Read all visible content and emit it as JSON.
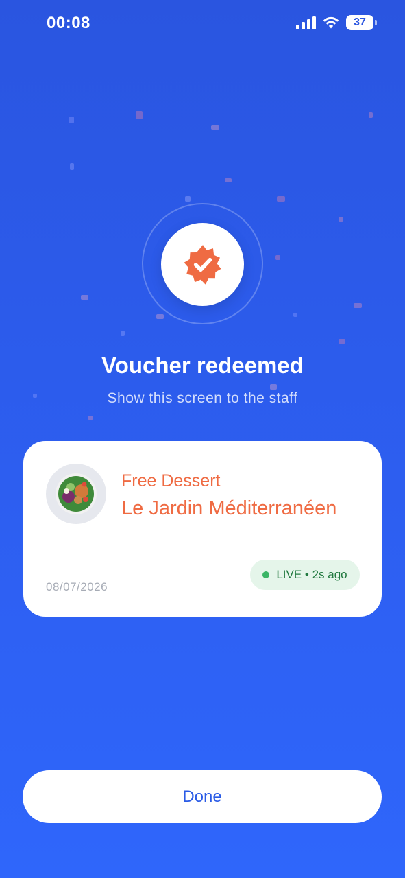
{
  "status_bar": {
    "time": "00:08",
    "battery_level": "37",
    "icons": [
      "cellular-signal-icon",
      "wifi-icon",
      "battery-icon"
    ]
  },
  "badge": {
    "icon": "verified-check-badge-icon",
    "accent_color": "#ef6b43"
  },
  "confirmation": {
    "title": "Voucher redeemed",
    "subtitle": "Show this screen to the staff"
  },
  "voucher_card": {
    "thumbnail": "food-bowl-image",
    "offer": "Free Dessert",
    "venue": "Le Jardin Méditerranéen",
    "date": "08/07/2026",
    "live_status": "LIVE • 2s ago",
    "live_color": "#3bb566"
  },
  "actions": {
    "done_label": "Done"
  },
  "colors": {
    "background": "#2d5ef0",
    "accent": "#ef6b43",
    "primary_text_on_white": "#2a5be6"
  }
}
